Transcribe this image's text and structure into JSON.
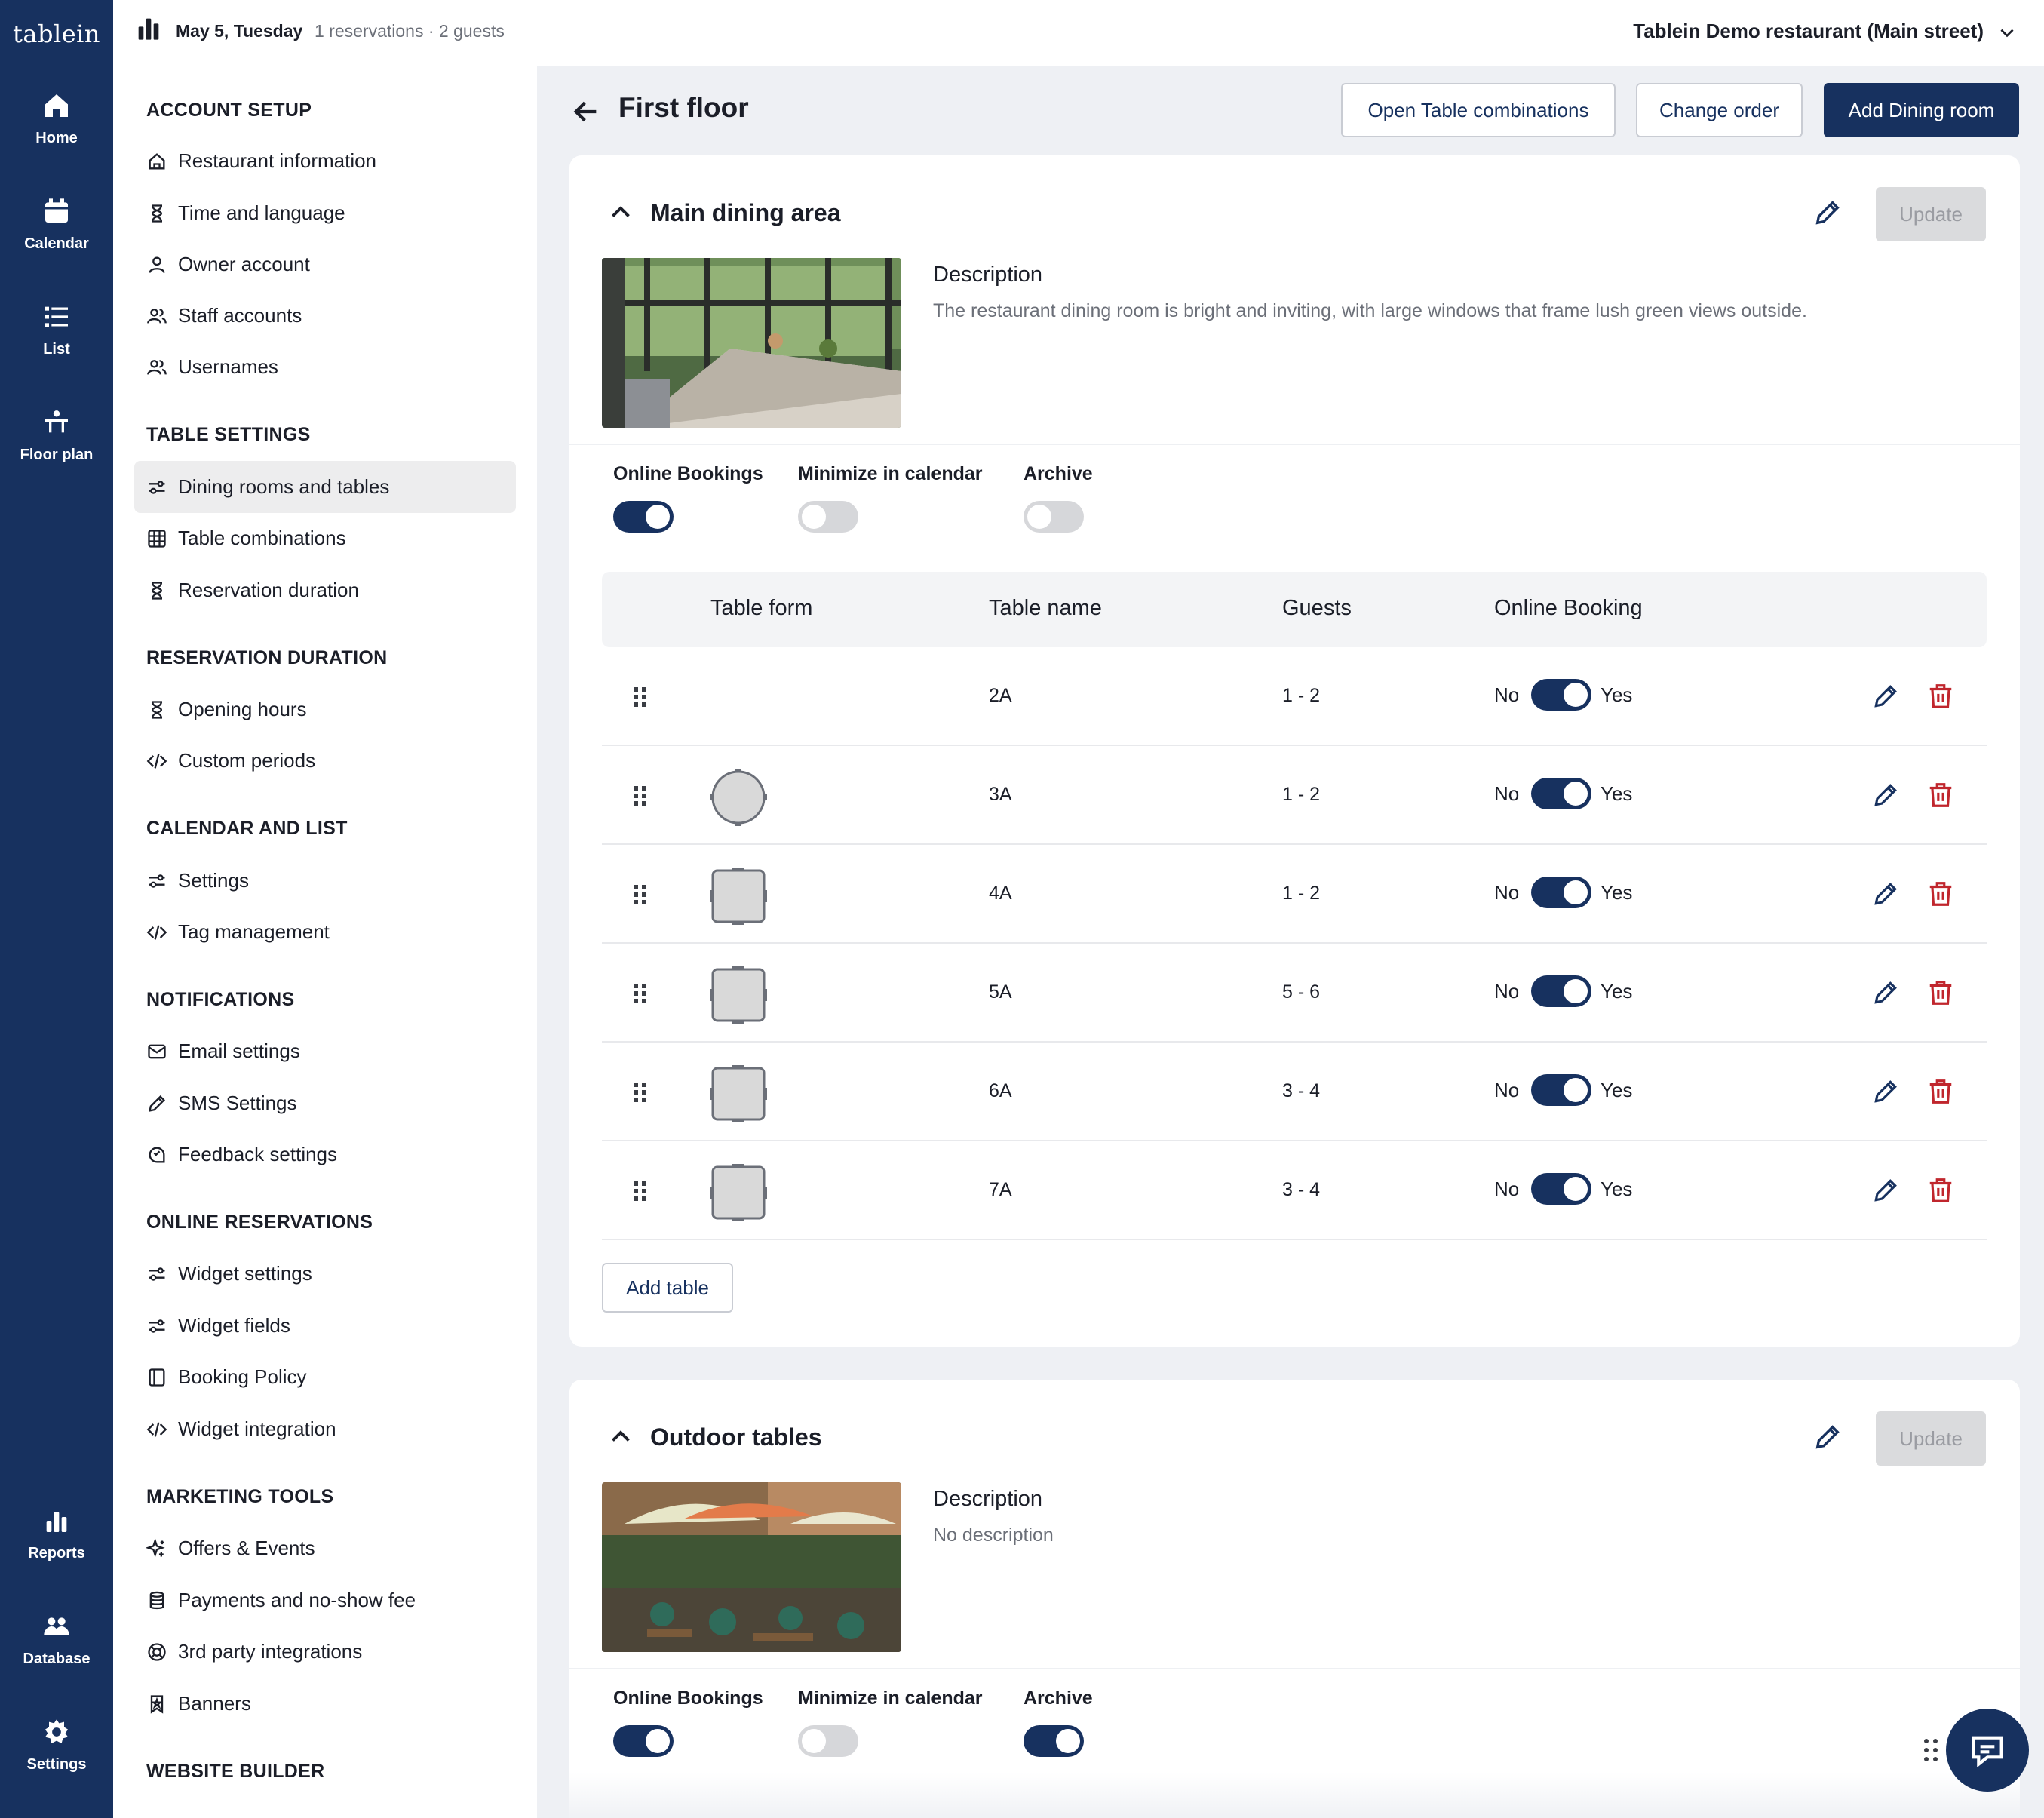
{
  "app": {
    "logo": "tablein"
  },
  "rail": [
    {
      "label": "Home",
      "icon": "home-icon"
    },
    {
      "label": "Calendar",
      "icon": "calendar-icon"
    },
    {
      "label": "List",
      "icon": "list-icon"
    },
    {
      "label": "Floor plan",
      "icon": "floor-plan-icon"
    },
    {
      "label": "Reports",
      "icon": "reports-icon"
    },
    {
      "label": "Database",
      "icon": "database-icon"
    },
    {
      "label": "Settings",
      "icon": "settings-icon"
    }
  ],
  "topbar": {
    "date": "May 5, Tuesday",
    "reservations": "1 reservations · 2 guests",
    "restaurant": "Tablein Demo restaurant (Main street)"
  },
  "sidebar": {
    "sections": [
      {
        "title": "ACCOUNT SETUP",
        "items": [
          {
            "label": "Restaurant information",
            "icon": "house-icon"
          },
          {
            "label": "Time and language",
            "icon": "hourglass-icon"
          },
          {
            "label": "Owner account",
            "icon": "user-icon"
          },
          {
            "label": "Staff accounts",
            "icon": "users-icon"
          },
          {
            "label": "Usernames",
            "icon": "users-icon"
          }
        ]
      },
      {
        "title": "TABLE SETTINGS",
        "items": [
          {
            "label": "Dining rooms and tables",
            "icon": "sliders-icon",
            "active": true
          },
          {
            "label": "Table combinations",
            "icon": "grid-icon"
          },
          {
            "label": "Reservation duration",
            "icon": "hourglass-icon"
          }
        ]
      },
      {
        "title": "RESERVATION DURATION",
        "items": [
          {
            "label": "Opening hours",
            "icon": "hourglass-icon"
          },
          {
            "label": "Custom periods",
            "icon": "code-icon"
          }
        ]
      },
      {
        "title": "CALENDAR AND LIST",
        "items": [
          {
            "label": "Settings",
            "icon": "sliders-icon"
          },
          {
            "label": "Tag management",
            "icon": "code-icon"
          }
        ]
      },
      {
        "title": "NOTIFICATIONS",
        "items": [
          {
            "label": "Email settings",
            "icon": "mail-icon"
          },
          {
            "label": "SMS Settings",
            "icon": "pencil-icon"
          },
          {
            "label": "Feedback settings",
            "icon": "feedback-icon"
          }
        ]
      },
      {
        "title": "ONLINE RESERVATIONS",
        "items": [
          {
            "label": "Widget settings",
            "icon": "sliders-icon"
          },
          {
            "label": "Widget fields",
            "icon": "sliders-icon"
          },
          {
            "label": "Booking Policy",
            "icon": "book-icon"
          },
          {
            "label": "Widget integration",
            "icon": "code-icon"
          }
        ]
      },
      {
        "title": "MARKETING TOOLS",
        "items": [
          {
            "label": "Offers & Events",
            "icon": "sparkle-icon"
          },
          {
            "label": "Payments and no-show fee",
            "icon": "coins-icon"
          },
          {
            "label": "3rd party integrations",
            "icon": "lifebuoy-icon"
          },
          {
            "label": "Banners",
            "icon": "bookmark-icon"
          }
        ]
      },
      {
        "title": "WEBSITE BUILDER",
        "items": []
      }
    ]
  },
  "main": {
    "title": "First floor",
    "buttons": {
      "combinations": "Open Table combinations",
      "order": "Change order",
      "add_room": "Add Dining room"
    },
    "rooms": [
      {
        "name": "Main dining area",
        "update_label": "Update",
        "description_heading": "Description",
        "description": "The restaurant dining room is bright and inviting, with large windows that frame lush green views outside.",
        "toggles": [
          {
            "label": "Online Bookings",
            "on": true
          },
          {
            "label": "Minimize in calendar",
            "on": false
          },
          {
            "label": "Archive",
            "on": false
          }
        ],
        "table_headers": [
          "Table form",
          "Table name",
          "Guests",
          "Online Booking"
        ],
        "tables": [
          {
            "form": "none",
            "name": "2A",
            "guests": "1 - 2",
            "online": true
          },
          {
            "form": "round",
            "name": "3A",
            "guests": "1 - 2",
            "online": true
          },
          {
            "form": "square",
            "name": "4A",
            "guests": "1 - 2",
            "online": true
          },
          {
            "form": "square",
            "name": "5A",
            "guests": "5 - 6",
            "online": true
          },
          {
            "form": "square",
            "name": "6A",
            "guests": "3 - 4",
            "online": true
          },
          {
            "form": "square",
            "name": "7A",
            "guests": "3 - 4",
            "online": true
          }
        ],
        "no_label": "No",
        "yes_label": "Yes",
        "add_table": "Add table"
      },
      {
        "name": "Outdoor tables",
        "update_label": "Update",
        "description_heading": "Description",
        "description": "No description",
        "toggles": [
          {
            "label": "Online Bookings",
            "on": true
          },
          {
            "label": "Minimize in calendar",
            "on": false
          },
          {
            "label": "Archive",
            "on": true
          }
        ]
      }
    ]
  },
  "colors": {
    "brand": "#17315f",
    "danger": "#c0262d",
    "muted": "#6b6f78"
  }
}
